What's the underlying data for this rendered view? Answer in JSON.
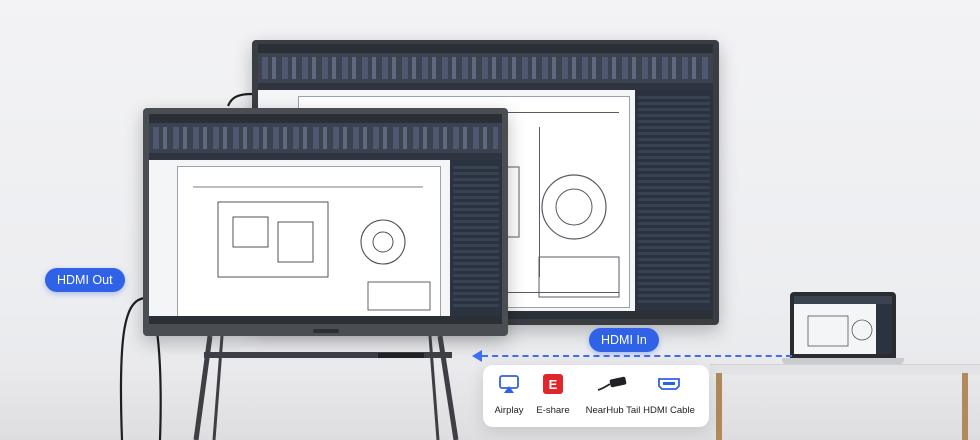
{
  "labels": {
    "hdmi_out": "HDMI Out",
    "hdmi_in": "HDMI In"
  },
  "options": [
    {
      "label": "Airplay",
      "icon": "airplay-icon"
    },
    {
      "label": "E-share",
      "icon": "e-share-icon"
    },
    {
      "label": "NearHub Tail",
      "icon": "nearhub-tail-icon"
    },
    {
      "label": "HDMI Cable",
      "icon": "hdmi-cable-icon"
    }
  ],
  "colors": {
    "accent": "#2f62e6",
    "eshare_red": "#e0262a",
    "cad_dark": "#3b4250"
  }
}
